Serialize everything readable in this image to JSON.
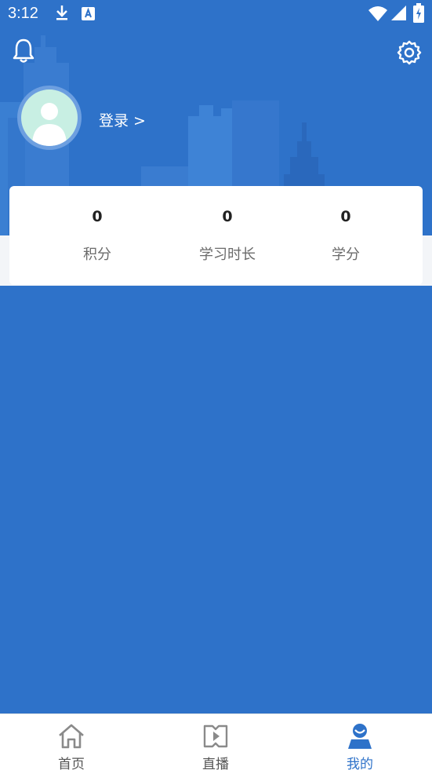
{
  "status_bar": {
    "time": "3:12"
  },
  "profile": {
    "login_label": "登录 >"
  },
  "stats": [
    {
      "value": "0",
      "label": "积分"
    },
    {
      "value": "0",
      "label": "学习时长"
    },
    {
      "value": "0",
      "label": "学分"
    }
  ],
  "bottom_nav": [
    {
      "label": "首页",
      "icon": "home-icon",
      "active": false
    },
    {
      "label": "直播",
      "icon": "live-icon",
      "active": false
    },
    {
      "label": "我的",
      "icon": "profile-icon",
      "active": true
    }
  ],
  "colors": {
    "primary": "#2e72c9",
    "avatar_bg": "#c8efe3",
    "card": "#ffffff"
  }
}
